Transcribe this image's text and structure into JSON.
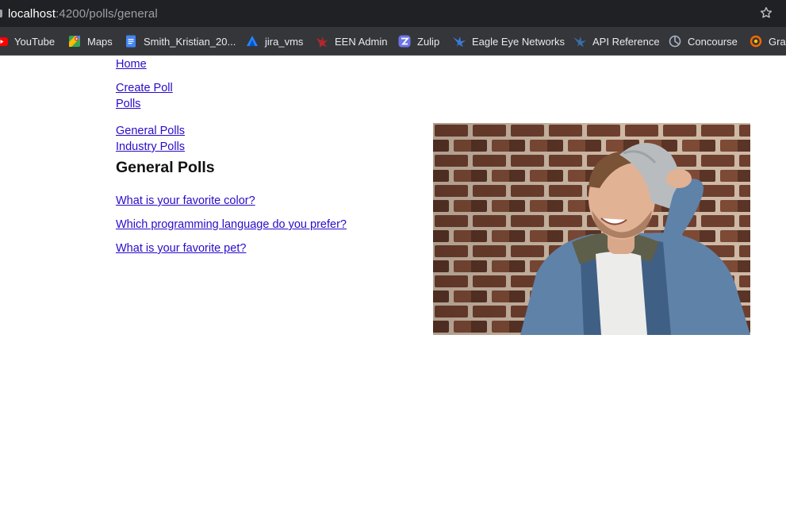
{
  "browser": {
    "url_host": "localhost",
    "url_path": ":4200/polls/general",
    "bookmarks": [
      {
        "label": "YouTube",
        "icon": "youtube-icon",
        "color": "#ff0000"
      },
      {
        "label": "Maps",
        "icon": "maps-icon",
        "color": "#34a853"
      },
      {
        "label": "Smith_Kristian_20...",
        "icon": "docs-icon",
        "color": "#4285f4"
      },
      {
        "label": "jira_vms",
        "icon": "jira-icon",
        "color": "#2684ff"
      },
      {
        "label": "EEN Admin",
        "icon": "een-icon",
        "color": "#b3262d"
      },
      {
        "label": "Zulip",
        "icon": "zulip-icon",
        "color": "#6c75e8"
      },
      {
        "label": "Eagle Eye Networks",
        "icon": "eagle-icon",
        "color": "#3a7bd5"
      },
      {
        "label": "API Reference",
        "icon": "api-icon",
        "color": "#3a6ea5"
      },
      {
        "label": "Concourse",
        "icon": "concourse-icon",
        "color": "#a8b4c4"
      },
      {
        "label": "Gra",
        "icon": "grafana-icon",
        "color": "#f46800"
      }
    ]
  },
  "nav": {
    "home": "Home",
    "create_poll": "Create Poll",
    "polls": "Polls",
    "general_polls": "General Polls",
    "industry_polls": "Industry Polls"
  },
  "main": {
    "title": "General Polls",
    "polls": [
      "What is your favorite color?",
      "Which programming language do you prefer?",
      "What is your favorite pet?"
    ]
  },
  "image": {
    "subject": "smiling man in beanie and denim jacket in front of brick wall"
  }
}
